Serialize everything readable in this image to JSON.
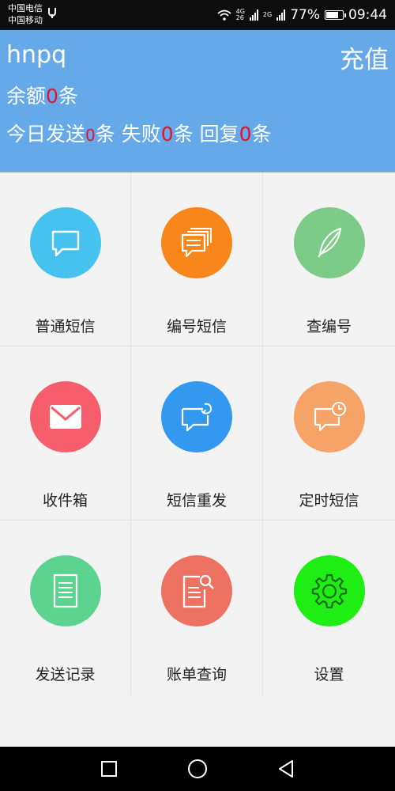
{
  "status_bar": {
    "carrier1": "中国电信",
    "carrier2": "中国移动",
    "net1": "4G",
    "net1b": "26",
    "net2": "2G",
    "battery": "77%",
    "battery_level": 0.77,
    "time": "09:44"
  },
  "header": {
    "username": "hnpq",
    "recharge_label": "充值",
    "balance_prefix": "余额",
    "balance_value": "0",
    "unit": "条",
    "today_label": "今日发送",
    "today_value": "0",
    "fail_label": "失败",
    "fail_value": "0",
    "reply_label": "回复",
    "reply_value": "0"
  },
  "grid": [
    {
      "label": "普通短信",
      "icon": "chat-bubble-icon",
      "color": "#45c3ee"
    },
    {
      "label": "编号短信",
      "icon": "multi-message-icon",
      "color": "#f9861a"
    },
    {
      "label": "查编号",
      "icon": "feather-icon",
      "color": "#7ccb86"
    },
    {
      "label": "收件箱",
      "icon": "envelope-icon",
      "color": "#f65e6b"
    },
    {
      "label": "短信重发",
      "icon": "message-resend-icon",
      "color": "#3398ef"
    },
    {
      "label": "定时短信",
      "icon": "message-clock-icon",
      "color": "#f6a367"
    },
    {
      "label": "发送记录",
      "icon": "document-icon",
      "color": "#5cd38f"
    },
    {
      "label": "账单查询",
      "icon": "bill-search-icon",
      "color": "#ee7262"
    },
    {
      "label": "设置",
      "icon": "gear-icon",
      "color": "#1fee14"
    }
  ],
  "nav": {
    "recent": "square-icon",
    "home": "circle-icon",
    "back": "triangle-icon"
  }
}
